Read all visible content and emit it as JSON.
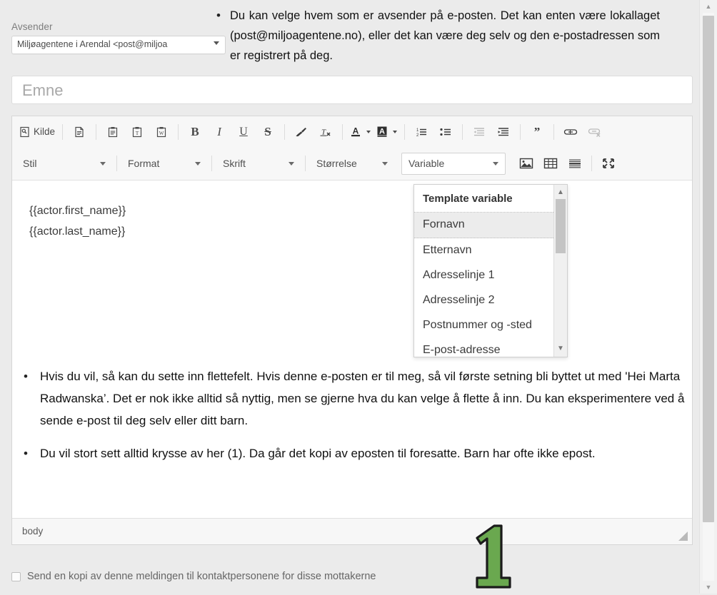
{
  "sender": {
    "label": "Avsender",
    "value": "Miljøagentene i Arendal <post@miljoa",
    "caret_icon": "chevron-down-icon"
  },
  "subject": {
    "placeholder": "Emne",
    "value": ""
  },
  "toolbar": {
    "row1": [
      {
        "name": "source-button",
        "label": "Kilde",
        "icon": "source-document-icon",
        "disabled": false
      },
      {
        "name": "new-page-button",
        "label": "",
        "icon": "new-page-icon",
        "disabled": false
      },
      {
        "name": "paste-button",
        "label": "",
        "icon": "paste-icon",
        "disabled": false
      },
      {
        "name": "paste-text-button",
        "label": "",
        "icon": "paste-as-plain-text-icon",
        "disabled": false
      },
      {
        "name": "paste-word-button",
        "label": "",
        "icon": "paste-from-word-icon",
        "disabled": false
      },
      {
        "name": "bold-button",
        "label": "B",
        "icon": "bold-icon",
        "disabled": false
      },
      {
        "name": "italic-button",
        "label": "I",
        "icon": "italic-icon",
        "disabled": false
      },
      {
        "name": "underline-button",
        "label": "U",
        "icon": "underline-icon",
        "disabled": false
      },
      {
        "name": "strikethrough-button",
        "label": "S",
        "icon": "strikethrough-icon",
        "disabled": false
      },
      {
        "name": "copy-formatting-button",
        "label": "",
        "icon": "paintbrush-icon",
        "disabled": false
      },
      {
        "name": "remove-format-button",
        "label": "",
        "icon": "remove-format-icon",
        "disabled": false
      },
      {
        "name": "text-color-button",
        "label": "",
        "icon": "text-color-icon",
        "disabled": false
      },
      {
        "name": "background-color-button",
        "label": "",
        "icon": "background-color-icon",
        "disabled": false
      },
      {
        "name": "numbered-list-button",
        "label": "",
        "icon": "numbered-list-icon",
        "disabled": false
      },
      {
        "name": "bulleted-list-button",
        "label": "",
        "icon": "bulleted-list-icon",
        "disabled": false
      },
      {
        "name": "decrease-indent-button",
        "label": "",
        "icon": "decrease-indent-icon",
        "disabled": true
      },
      {
        "name": "increase-indent-button",
        "label": "",
        "icon": "increase-indent-icon",
        "disabled": false
      },
      {
        "name": "blockquote-button",
        "label": "",
        "icon": "blockquote-icon",
        "disabled": false
      },
      {
        "name": "link-button",
        "label": "",
        "icon": "link-icon",
        "disabled": false
      },
      {
        "name": "unlink-button",
        "label": "",
        "icon": "unlink-icon",
        "disabled": true
      }
    ],
    "row2": {
      "style": "Stil",
      "format": "Format",
      "font": "Skrift",
      "size": "Størrelse",
      "variable": "Variable",
      "image_icon": "image-icon",
      "table_icon": "table-icon",
      "horizontal_rule_icon": "horizontal-rule-icon",
      "maximize_icon": "maximize-icon"
    }
  },
  "variable_menu": {
    "title": "Template variable",
    "items": [
      "Fornavn",
      "Etternavn",
      "Adresselinje 1",
      "Adresselinje 2",
      "Postnummer og -sted",
      "E-post-adresse"
    ],
    "selected": "Fornavn"
  },
  "editor_body": {
    "lines": [
      "{{actor.first_name}}",
      "{{actor.last_name}}"
    ]
  },
  "editor_footer": {
    "path": "body",
    "resize_icon": "resize-grip-icon"
  },
  "notes": [
    {
      "bullet": "•",
      "text": "Du kan velge hvem som er avsender på e-posten. Det kan enten være lokallaget (post@miljoagentene.no), eller det kan være deg selv og den e-postadressen som er registrert på deg."
    },
    {
      "bullet": "•",
      "text": "Hvis du vil, så kan du sette inn flettefelt. Hvis denne e-posten er til meg, så vil første setning bli byttet ut med 'Hei Marta Radwanska’. Det er nok ikke alltid så nyttig, men se gjerne hva du kan velge å flette å inn. Du kan eksperimentere ved å sende e-post til deg selv eller ditt barn."
    },
    {
      "bullet": "•",
      "text": "Du vil stort sett alltid krysse av her (1). Da går det kopi av eposten til foresatte. Barn har ofte ikke epost."
    }
  ],
  "copy_option": {
    "label": "Send en kopi av denne meldingen til kontaktpersonene for disse mottakerne",
    "checked": false
  },
  "annotation": {
    "number": "1",
    "color": "#6aa84f",
    "outline": "#1b1b1b"
  },
  "scrollbar": {
    "up_arrow": "▲",
    "down_arrow": "▼"
  }
}
